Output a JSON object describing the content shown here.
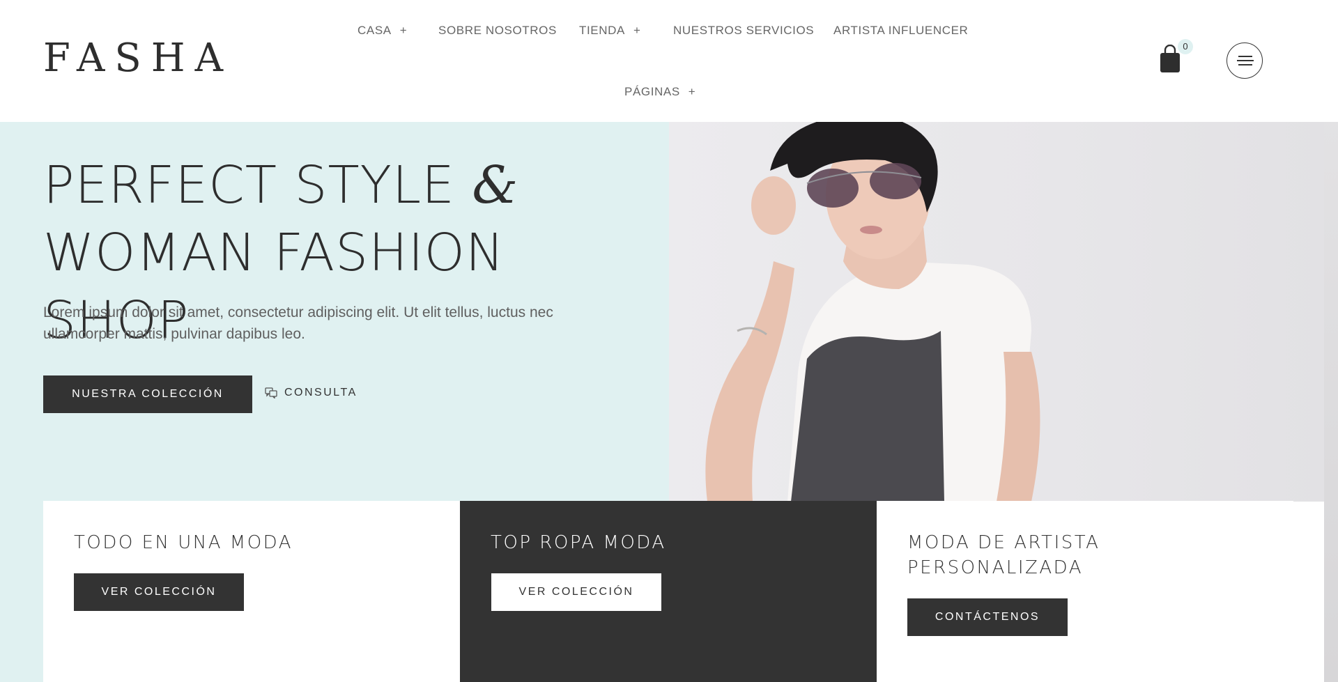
{
  "brand": {
    "logo": "FASHA"
  },
  "nav": {
    "items": [
      {
        "label": "CASA",
        "has_submenu": true,
        "plus": "+"
      },
      {
        "label": "SOBRE NOSOTROS",
        "has_submenu": false
      },
      {
        "label": "TIENDA",
        "has_submenu": true,
        "plus": "+"
      },
      {
        "label": "NUESTROS SERVICIOS",
        "has_submenu": false
      },
      {
        "label": "ARTISTA INFLUENCER",
        "has_submenu": false
      },
      {
        "label": "PÁGINAS",
        "has_submenu": true,
        "plus": "+"
      }
    ]
  },
  "cart": {
    "count": "0",
    "icon": "shopping-bag-icon"
  },
  "menu": {
    "icon": "hamburger-menu-icon"
  },
  "hero": {
    "title_line1": "PERFECT STYLE",
    "title_amp": "&",
    "title_line2": "WOMAN FASHION SHOP",
    "description": "Lorem ipsum dolor sit amet, consectetur adipiscing elit. Ut elit tellus, luctus nec ullamcorper mattis, pulvinar dapibus leo.",
    "primary_button": "NUESTRA COLECCIÓN",
    "secondary_button": "CONSULTA",
    "secondary_icon": "chat-icon"
  },
  "features": [
    {
      "title": "TODO EN UNA MODA",
      "button": "VER COLECCIÓN",
      "theme": "light"
    },
    {
      "title": "TOP ROPA MODA",
      "button": "VER COLECCIÓN",
      "theme": "dark"
    },
    {
      "title": "MODA DE ARTISTA PERSONALIZADA",
      "button": "CONTÁCTENOS",
      "theme": "light"
    }
  ],
  "colors": {
    "accent_bg": "#e0f1f1",
    "dark": "#333333",
    "text_muted": "#666666",
    "white": "#ffffff"
  }
}
